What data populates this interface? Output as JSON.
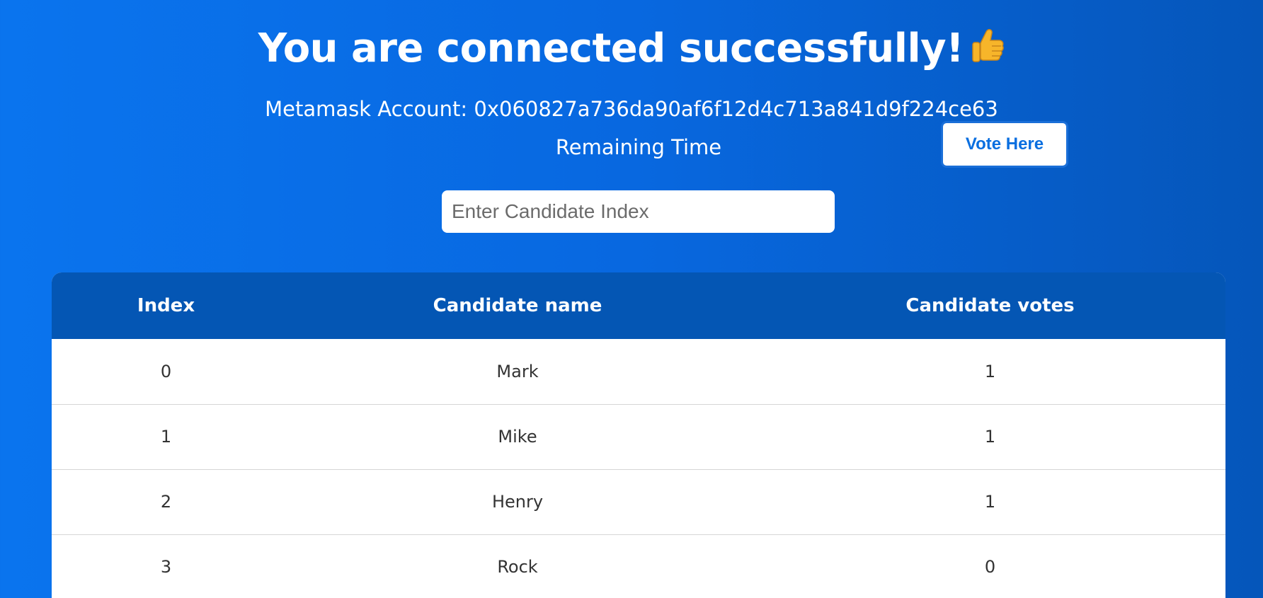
{
  "header": {
    "title": "You are connected successfully!",
    "title_emoji": "thumbs-up-icon",
    "account_label": "Metamask Account: 0x060827a736da90af6f12d4c713a841d9f224ce63",
    "remaining_time_label": "Remaining Time"
  },
  "vote": {
    "button_label": "Vote Here",
    "input_placeholder": "Enter Candidate Index",
    "input_value": ""
  },
  "table": {
    "columns": [
      "Index",
      "Candidate name",
      "Candidate votes"
    ],
    "rows": [
      {
        "index": "0",
        "name": "Mark",
        "votes": "1"
      },
      {
        "index": "1",
        "name": "Mike",
        "votes": "1"
      },
      {
        "index": "2",
        "name": "Henry",
        "votes": "1"
      },
      {
        "index": "3",
        "name": "Rock",
        "votes": "0"
      }
    ]
  },
  "colors": {
    "background_left": "#0a74ee",
    "background_right": "#0556ba",
    "table_header": "#0456b4",
    "button_text": "#0a6fe0"
  }
}
